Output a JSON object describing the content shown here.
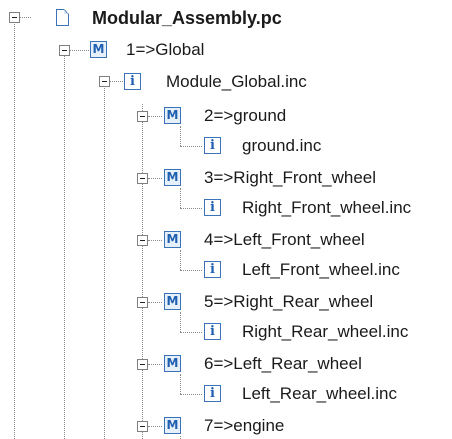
{
  "tree": {
    "root": {
      "label": "Modular_Assembly.pc",
      "icon": "file-icon"
    },
    "global_module": {
      "label": "1=>Global",
      "icon": "module-icon"
    },
    "global_include": {
      "label": "Module_Global.inc",
      "icon": "include-file-icon"
    },
    "modules": [
      {
        "label": "2=>ground",
        "include": "ground.inc"
      },
      {
        "label": "3=>Right_Front_wheel",
        "include": "Right_Front_wheel.inc"
      },
      {
        "label": "4=>Left_Front_wheel",
        "include": "Left_Front_wheel.inc"
      },
      {
        "label": "5=>Right_Rear_wheel",
        "include": "Right_Rear_wheel.inc"
      },
      {
        "label": "6=>Left_Rear_wheel",
        "include": "Left_Rear_wheel.inc"
      },
      {
        "label": "7=>engine"
      }
    ],
    "module_icon_glyph": "M",
    "include_icon_glyph": "i"
  },
  "colors": {
    "icon_border": "#3b73b9",
    "icon_text": "#1f5fb0",
    "connector": "#8a8a8a"
  }
}
